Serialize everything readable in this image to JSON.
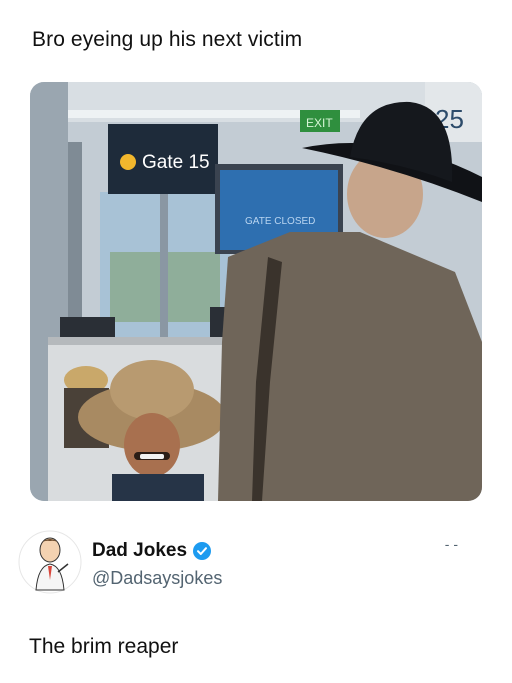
{
  "post": {
    "caption": "Bro eyeing up his next victim",
    "image_signs": {
      "gate": "Gate 15",
      "screen": "GATE CLOSED",
      "exit": "EXIT",
      "gate_number": "25"
    },
    "author": {
      "name": "Dad Jokes",
      "handle": "@Dadsaysjokes",
      "verified": true,
      "more_label": "- -",
      "avatar_icon": "cartoon-dad-avatar-icon",
      "verified_icon": "verified-badge-icon"
    },
    "text": "The brim reaper"
  },
  "colors": {
    "verified_blue": "#1d9bf0",
    "handle_gray": "#536471",
    "sign_navy": "#1e2b3a",
    "screen_blue": "#2e6fb0"
  }
}
